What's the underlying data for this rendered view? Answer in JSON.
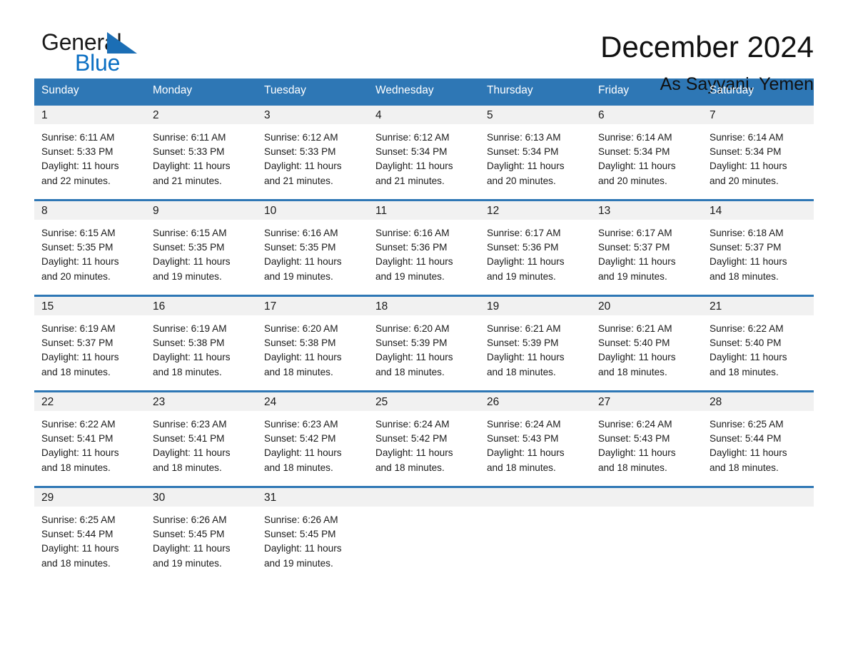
{
  "brand": {
    "name_part1": "General",
    "name_part2": "Blue",
    "triangle_color": "#1B6EB5",
    "blue_color": "#0B6FC3"
  },
  "header": {
    "month_title": "December 2024",
    "location": "As Sayyani, Yemen"
  },
  "theme": {
    "header_blue": "#2E77B5",
    "daynum_band": "#f1f1f1",
    "text": "#1a1a1a"
  },
  "weekday_headers": [
    "Sunday",
    "Monday",
    "Tuesday",
    "Wednesday",
    "Thursday",
    "Friday",
    "Saturday"
  ],
  "weeks": [
    [
      {
        "day": "1",
        "sunrise": "Sunrise: 6:11 AM",
        "sunset": "Sunset: 5:33 PM",
        "daylight_line1": "Daylight: 11 hours",
        "daylight_line2": "and 22 minutes."
      },
      {
        "day": "2",
        "sunrise": "Sunrise: 6:11 AM",
        "sunset": "Sunset: 5:33 PM",
        "daylight_line1": "Daylight: 11 hours",
        "daylight_line2": "and 21 minutes."
      },
      {
        "day": "3",
        "sunrise": "Sunrise: 6:12 AM",
        "sunset": "Sunset: 5:33 PM",
        "daylight_line1": "Daylight: 11 hours",
        "daylight_line2": "and 21 minutes."
      },
      {
        "day": "4",
        "sunrise": "Sunrise: 6:12 AM",
        "sunset": "Sunset: 5:34 PM",
        "daylight_line1": "Daylight: 11 hours",
        "daylight_line2": "and 21 minutes."
      },
      {
        "day": "5",
        "sunrise": "Sunrise: 6:13 AM",
        "sunset": "Sunset: 5:34 PM",
        "daylight_line1": "Daylight: 11 hours",
        "daylight_line2": "and 20 minutes."
      },
      {
        "day": "6",
        "sunrise": "Sunrise: 6:14 AM",
        "sunset": "Sunset: 5:34 PM",
        "daylight_line1": "Daylight: 11 hours",
        "daylight_line2": "and 20 minutes."
      },
      {
        "day": "7",
        "sunrise": "Sunrise: 6:14 AM",
        "sunset": "Sunset: 5:34 PM",
        "daylight_line1": "Daylight: 11 hours",
        "daylight_line2": "and 20 minutes."
      }
    ],
    [
      {
        "day": "8",
        "sunrise": "Sunrise: 6:15 AM",
        "sunset": "Sunset: 5:35 PM",
        "daylight_line1": "Daylight: 11 hours",
        "daylight_line2": "and 20 minutes."
      },
      {
        "day": "9",
        "sunrise": "Sunrise: 6:15 AM",
        "sunset": "Sunset: 5:35 PM",
        "daylight_line1": "Daylight: 11 hours",
        "daylight_line2": "and 19 minutes."
      },
      {
        "day": "10",
        "sunrise": "Sunrise: 6:16 AM",
        "sunset": "Sunset: 5:35 PM",
        "daylight_line1": "Daylight: 11 hours",
        "daylight_line2": "and 19 minutes."
      },
      {
        "day": "11",
        "sunrise": "Sunrise: 6:16 AM",
        "sunset": "Sunset: 5:36 PM",
        "daylight_line1": "Daylight: 11 hours",
        "daylight_line2": "and 19 minutes."
      },
      {
        "day": "12",
        "sunrise": "Sunrise: 6:17 AM",
        "sunset": "Sunset: 5:36 PM",
        "daylight_line1": "Daylight: 11 hours",
        "daylight_line2": "and 19 minutes."
      },
      {
        "day": "13",
        "sunrise": "Sunrise: 6:17 AM",
        "sunset": "Sunset: 5:37 PM",
        "daylight_line1": "Daylight: 11 hours",
        "daylight_line2": "and 19 minutes."
      },
      {
        "day": "14",
        "sunrise": "Sunrise: 6:18 AM",
        "sunset": "Sunset: 5:37 PM",
        "daylight_line1": "Daylight: 11 hours",
        "daylight_line2": "and 18 minutes."
      }
    ],
    [
      {
        "day": "15",
        "sunrise": "Sunrise: 6:19 AM",
        "sunset": "Sunset: 5:37 PM",
        "daylight_line1": "Daylight: 11 hours",
        "daylight_line2": "and 18 minutes."
      },
      {
        "day": "16",
        "sunrise": "Sunrise: 6:19 AM",
        "sunset": "Sunset: 5:38 PM",
        "daylight_line1": "Daylight: 11 hours",
        "daylight_line2": "and 18 minutes."
      },
      {
        "day": "17",
        "sunrise": "Sunrise: 6:20 AM",
        "sunset": "Sunset: 5:38 PM",
        "daylight_line1": "Daylight: 11 hours",
        "daylight_line2": "and 18 minutes."
      },
      {
        "day": "18",
        "sunrise": "Sunrise: 6:20 AM",
        "sunset": "Sunset: 5:39 PM",
        "daylight_line1": "Daylight: 11 hours",
        "daylight_line2": "and 18 minutes."
      },
      {
        "day": "19",
        "sunrise": "Sunrise: 6:21 AM",
        "sunset": "Sunset: 5:39 PM",
        "daylight_line1": "Daylight: 11 hours",
        "daylight_line2": "and 18 minutes."
      },
      {
        "day": "20",
        "sunrise": "Sunrise: 6:21 AM",
        "sunset": "Sunset: 5:40 PM",
        "daylight_line1": "Daylight: 11 hours",
        "daylight_line2": "and 18 minutes."
      },
      {
        "day": "21",
        "sunrise": "Sunrise: 6:22 AM",
        "sunset": "Sunset: 5:40 PM",
        "daylight_line1": "Daylight: 11 hours",
        "daylight_line2": "and 18 minutes."
      }
    ],
    [
      {
        "day": "22",
        "sunrise": "Sunrise: 6:22 AM",
        "sunset": "Sunset: 5:41 PM",
        "daylight_line1": "Daylight: 11 hours",
        "daylight_line2": "and 18 minutes."
      },
      {
        "day": "23",
        "sunrise": "Sunrise: 6:23 AM",
        "sunset": "Sunset: 5:41 PM",
        "daylight_line1": "Daylight: 11 hours",
        "daylight_line2": "and 18 minutes."
      },
      {
        "day": "24",
        "sunrise": "Sunrise: 6:23 AM",
        "sunset": "Sunset: 5:42 PM",
        "daylight_line1": "Daylight: 11 hours",
        "daylight_line2": "and 18 minutes."
      },
      {
        "day": "25",
        "sunrise": "Sunrise: 6:24 AM",
        "sunset": "Sunset: 5:42 PM",
        "daylight_line1": "Daylight: 11 hours",
        "daylight_line2": "and 18 minutes."
      },
      {
        "day": "26",
        "sunrise": "Sunrise: 6:24 AM",
        "sunset": "Sunset: 5:43 PM",
        "daylight_line1": "Daylight: 11 hours",
        "daylight_line2": "and 18 minutes."
      },
      {
        "day": "27",
        "sunrise": "Sunrise: 6:24 AM",
        "sunset": "Sunset: 5:43 PM",
        "daylight_line1": "Daylight: 11 hours",
        "daylight_line2": "and 18 minutes."
      },
      {
        "day": "28",
        "sunrise": "Sunrise: 6:25 AM",
        "sunset": "Sunset: 5:44 PM",
        "daylight_line1": "Daylight: 11 hours",
        "daylight_line2": "and 18 minutes."
      }
    ],
    [
      {
        "day": "29",
        "sunrise": "Sunrise: 6:25 AM",
        "sunset": "Sunset: 5:44 PM",
        "daylight_line1": "Daylight: 11 hours",
        "daylight_line2": "and 18 minutes."
      },
      {
        "day": "30",
        "sunrise": "Sunrise: 6:26 AM",
        "sunset": "Sunset: 5:45 PM",
        "daylight_line1": "Daylight: 11 hours",
        "daylight_line2": "and 19 minutes."
      },
      {
        "day": "31",
        "sunrise": "Sunrise: 6:26 AM",
        "sunset": "Sunset: 5:45 PM",
        "daylight_line1": "Daylight: 11 hours",
        "daylight_line2": "and 19 minutes."
      },
      {
        "day": "",
        "sunrise": "",
        "sunset": "",
        "daylight_line1": "",
        "daylight_line2": ""
      },
      {
        "day": "",
        "sunrise": "",
        "sunset": "",
        "daylight_line1": "",
        "daylight_line2": ""
      },
      {
        "day": "",
        "sunrise": "",
        "sunset": "",
        "daylight_line1": "",
        "daylight_line2": ""
      },
      {
        "day": "",
        "sunrise": "",
        "sunset": "",
        "daylight_line1": "",
        "daylight_line2": ""
      }
    ]
  ]
}
